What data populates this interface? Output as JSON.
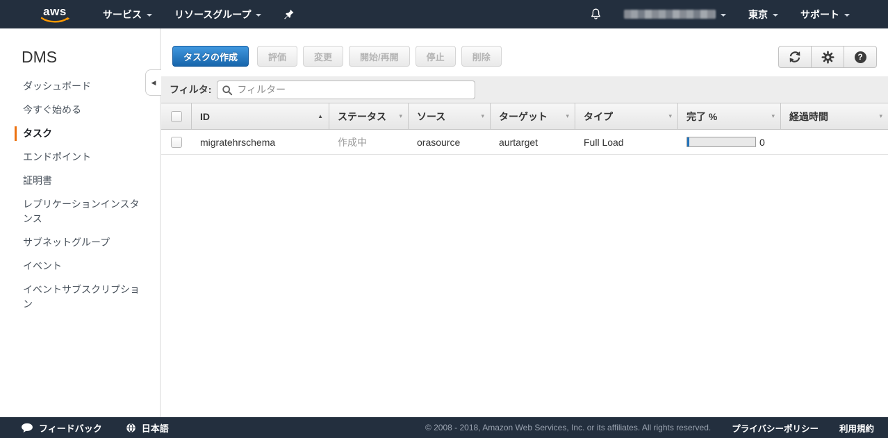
{
  "colors": {
    "topbar": "#232f3e",
    "accent_orange": "#ec7211",
    "primary_button_blue": "#1765ab",
    "progress_blue": "#2273ba",
    "aws_smile_orange": "#ff9900"
  },
  "icons": {
    "collapse_left": "◀",
    "sort_asc": "▲",
    "caret_down": "▾",
    "help_glyph": "?"
  },
  "topnav": {
    "logo_text": "aws",
    "services_label": "サービス",
    "resource_groups_label": "リソースグループ",
    "region_label": "東京",
    "support_label": "サポート"
  },
  "sidebar": {
    "title": "DMS",
    "items": [
      {
        "label": "ダッシュボード",
        "selected": false
      },
      {
        "label": "今すぐ始める",
        "selected": false
      },
      {
        "label": "タスク",
        "selected": true
      },
      {
        "label": "エンドポイント",
        "selected": false
      },
      {
        "label": "証明書",
        "selected": false
      },
      {
        "label": "レプリケーションインスタンス",
        "selected": false
      },
      {
        "label": "サブネットグループ",
        "selected": false
      },
      {
        "label": "イベント",
        "selected": false
      },
      {
        "label": "イベントサブスクリプション",
        "selected": false
      }
    ]
  },
  "toolbar": {
    "create_task": "タスクの作成",
    "assess": "評価",
    "modify": "変更",
    "start_resume": "開始/再開",
    "stop": "停止",
    "delete": "削除"
  },
  "filter": {
    "label": "フィルタ:",
    "placeholder": "フィルター"
  },
  "table": {
    "columns": [
      "ID",
      "ステータス",
      "ソース",
      "ターゲット",
      "タイプ",
      "完了 %",
      "経過時間"
    ],
    "row": {
      "id": "migratehrschema",
      "status": "作成中",
      "source": "orasource",
      "target": "aurtarget",
      "type": "Full Load",
      "progress_pct": 0,
      "progress_text": "0",
      "elapsed": ""
    }
  },
  "footer": {
    "feedback": "フィードバック",
    "language": "日本語",
    "copyright": "© 2008 - 2018, Amazon Web Services, Inc. or its affiliates. All rights reserved.",
    "privacy": "プライバシーポリシー",
    "terms": "利用規約"
  }
}
